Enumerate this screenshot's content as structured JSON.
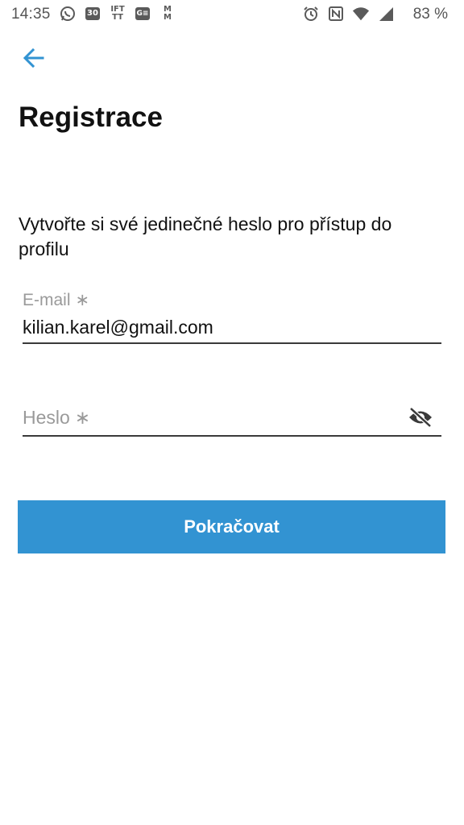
{
  "status_bar": {
    "time": "14:35",
    "battery": "83 %",
    "left_icons": [
      "whatsapp-icon",
      "calendar-icon",
      "ifttt-icon",
      "gmail-icon",
      "mail-icon"
    ],
    "right_icons": [
      "alarm-icon",
      "nfc-icon",
      "wifi-icon",
      "signal-icon"
    ],
    "calendar_day": "30",
    "ifttt_text": "IFT\nTT",
    "gmail_text": "G≡",
    "mail_text": "M\nM"
  },
  "header": {
    "back_icon": "arrow-left-icon",
    "title": "Registrace"
  },
  "form": {
    "description": "Vytvořte si své jedinečné heslo pro přístup do profilu",
    "email": {
      "label": "E-mail",
      "required_mark": "∗",
      "value": "kilian.karel@gmail.com"
    },
    "password": {
      "placeholder": "Heslo",
      "required_mark": "∗",
      "value": "",
      "toggle_icon": "eye-off-icon"
    },
    "continue_label": "Pokračovat"
  },
  "colors": {
    "accent": "#3293d2",
    "text": "#111111",
    "hint": "#9a9a9a",
    "underline": "#3a3a3a"
  }
}
